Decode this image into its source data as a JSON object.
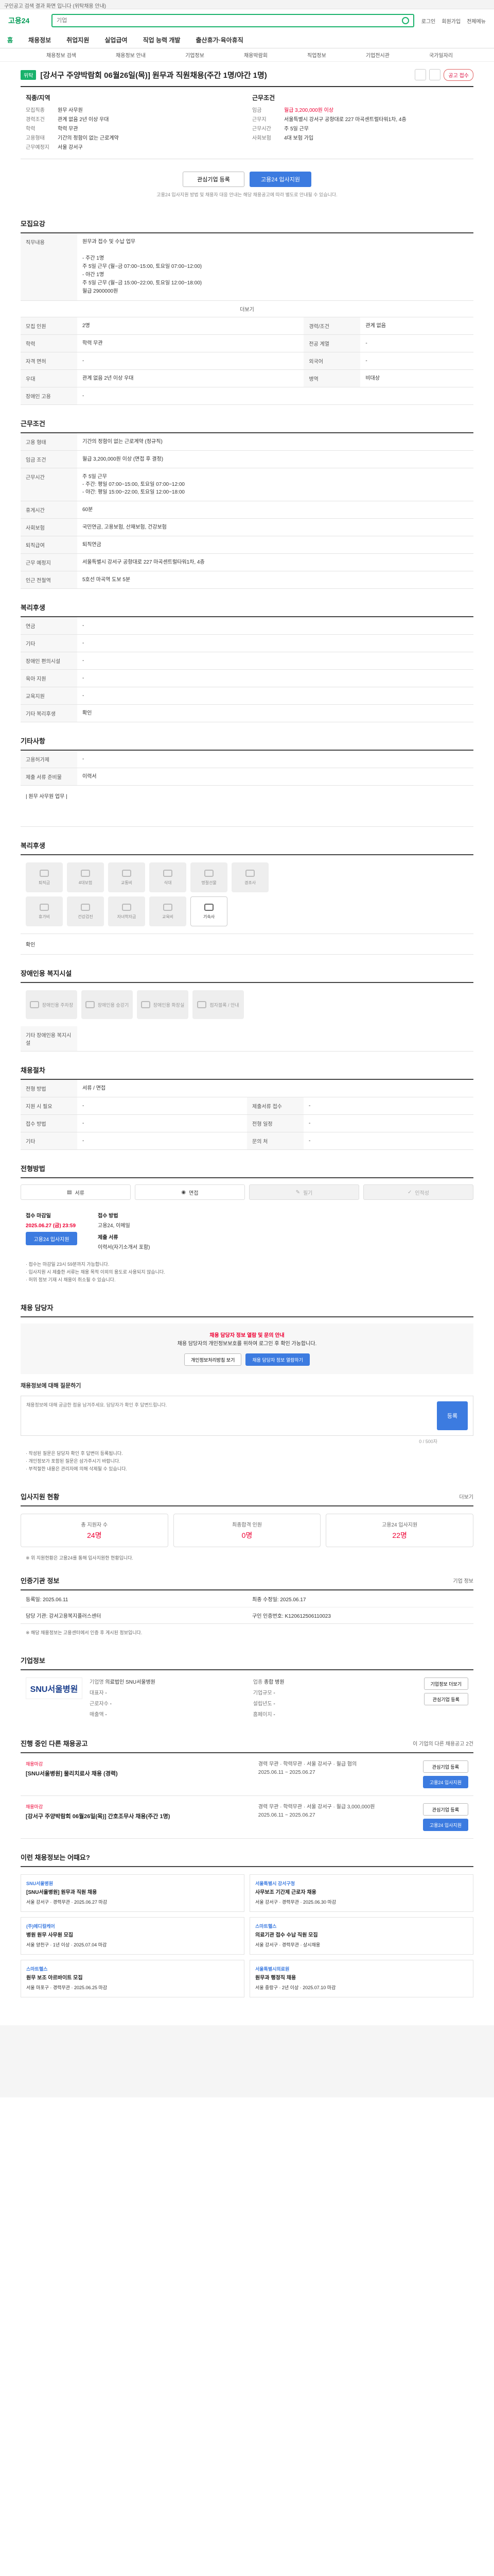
{
  "notice": "구인공고 검색 결과 화면 입니다 (위탁채용 안내)",
  "header": {
    "logo": "고용24",
    "search_placeholder": "기업",
    "menu": [
      "로그인",
      "회원가입",
      "전체메뉴"
    ]
  },
  "gnb": [
    "홈",
    "채용정보",
    "취업지원",
    "실업급여",
    "직업 능력 개발",
    "출산휴가·육아휴직"
  ],
  "subtabs": [
    "채용정보 검색",
    "채용정보 안내",
    "기업정보",
    "채용박람회",
    "직업정보",
    "기업전시관",
    "국가일자리"
  ],
  "job": {
    "badge": "위탁",
    "title": "[강서구 주양박람회 06월26일(목)] 원무과 직원채용(주간 1명/야간 1명)",
    "apply_badge": "공고 접수"
  },
  "summary": {
    "left_title": "직종/지역",
    "left": [
      {
        "k": "모집직종",
        "v": "원무 사무원"
      },
      {
        "k": "경력조건",
        "v": "관계 없음 2년 이상 우대"
      },
      {
        "k": "학력",
        "v": "학력 무관"
      },
      {
        "k": "고용형태",
        "v": "기간의 정함이 없는 근로계약"
      },
      {
        "k": "근무예정지",
        "v": "서울 강서구"
      }
    ],
    "right_title": "근무조건",
    "right": [
      {
        "k": "임금",
        "v": "월급 3,200,000원 이상"
      },
      {
        "k": "근무지",
        "v": "서울특별시 강서구 공항대로 227 마곡센트럴타워1차, 4층"
      },
      {
        "k": "근무시간",
        "v": "주 5일 근무"
      },
      {
        "k": "사회보험",
        "v": "4대 보험 가입"
      }
    ]
  },
  "actions": {
    "interest": "관심기업 등록",
    "apply": "고용24 입사지원",
    "note": "고용24 입사지원 방법 및 채용자 대응 안내는 해당 채용공고에 따라 별도로 안내될 수 있습니다."
  },
  "recruit": {
    "title": "모집요강",
    "job_desc_label": "직무내용",
    "job_desc": "원무과 접수 및 수납 업무\n\n- 주간 1명\n  주 5일 근무 (월~금 07:00~15:00, 토요일 07:00~12:00)\n- 야간 1명\n  주 5일 근무 (월~금 15:00~22:00, 토요일 12:00~18:00)\n  월급 2900000원",
    "more": "더보기",
    "rows": [
      {
        "k": "모집 인원",
        "v": "2명",
        "k2": "경력/조건",
        "v2": "관계 없음"
      },
      {
        "k": "학력",
        "v": "학력 무관",
        "k2": "전공 계열",
        "v2": "-"
      },
      {
        "k": "자격 면허",
        "v": "-",
        "k2": "외국어",
        "v2": "-"
      },
      {
        "k": "우대",
        "v": "관계 없음 2년 이상 우대",
        "k2": "병역",
        "v2": "비대상"
      },
      {
        "k": "장애인 고용",
        "v": "-",
        "k2": "",
        "v2": ""
      }
    ]
  },
  "conditions": {
    "title": "근무조건",
    "rows": [
      {
        "k": "고용 형태",
        "v": "기간의 정함이 없는 근로계약 (정규직)"
      },
      {
        "k": "임금 조건",
        "v": "월급 3,200,000원 이상 (면접 후 결정)"
      },
      {
        "k": "근무시간",
        "v": "주 5일 근무\n- 주간: 평일 07:00~15:00, 토요일 07:00~12:00\n- 야간: 평일 15:00~22:00, 토요일 12:00~18:00"
      },
      {
        "k": "휴게시간",
        "v": "60분"
      },
      {
        "k": "사회보험",
        "v": "국민연금, 고용보험, 산재보험, 건강보험"
      },
      {
        "k": "퇴직급여",
        "v": "퇴직연금"
      },
      {
        "k": "근무 예정지",
        "v": "서울특별시 강서구 공항대로 227 마곡센트럴타워1차, 4층"
      },
      {
        "k": "인근 전철역",
        "v": "5호선 마곡역 도보 5분"
      }
    ]
  },
  "welfare": {
    "title": "복리후생",
    "rows": [
      {
        "k": "연금",
        "v": "-"
      },
      {
        "k": "기타",
        "v": "-"
      },
      {
        "k": "장애인 편의시설",
        "v": "-"
      },
      {
        "k": "육아 지원",
        "v": "-"
      },
      {
        "k": "교육지원",
        "v": "-"
      },
      {
        "k": "기타 복리후생",
        "v": "확인"
      }
    ]
  },
  "other": {
    "title": "기타사항",
    "rows": [
      {
        "k": "고용허가제",
        "v": "-"
      },
      {
        "k": "제출 서류 준비물",
        "v": "이력서"
      }
    ],
    "detail": "| 원무 사무원 업무 |"
  },
  "disability": {
    "title": "복리후생",
    "items": [
      "퇴직금",
      "4대보험",
      "교통비",
      "식대",
      "명절선물",
      "경조사",
      "휴가비",
      "건강검진",
      "자녀학자금",
      "교육비",
      "기숙사",
      "사내카페"
    ]
  },
  "disability_fac": {
    "title": "장애인용 복지시설",
    "items": [
      "장애인용 주차장",
      "장애인용 승강기",
      "장애인용 화장실",
      "점자블록 / 안내"
    ],
    "note": "기타 장애인용 복지시설"
  },
  "selection": {
    "title": "채용절차",
    "rows": [
      {
        "k": "전형 방법",
        "v": "서류 / 면접",
        "k2": "",
        "v2": ""
      },
      {
        "k": "지원 시 필요",
        "v": "-",
        "k2": "제출서류 접수",
        "v2": "-"
      },
      {
        "k": "접수 방법",
        "v": "-",
        "k2": "전형 일정",
        "v2": "-"
      },
      {
        "k": "기타",
        "v": "-",
        "k2": "문의 처",
        "v2": "-"
      }
    ]
  },
  "apply": {
    "title": "전형방법",
    "methods": [
      "서류",
      "면접",
      "필기",
      "인적성"
    ],
    "period_label": "접수 마감일",
    "period_value": "2025.06.27 (금) 23:59",
    "period_btn": "고용24 입사지원",
    "how_label": "접수 방법",
    "how_value": "고용24, 이메일",
    "docs_label": "제출 서류",
    "docs_value": "이력서(자기소개서 포함)",
    "bullets": [
      "· 접수는 마감일 23시 59분까지 가능합니다.",
      "· 입사지원 시 제출한 서류는 채용 목적 이외의 용도로 사용되지 않습니다.",
      "· 허위 정보 기재 시 채용이 취소될 수 있습니다."
    ]
  },
  "contact": {
    "title": "채용 담당자",
    "alert_red": "채용 담당자 정보 열람 및 문의 안내",
    "alert_text": "채용 담당자의 개인정보보호를 위하여 로그인 후 확인 가능합니다.",
    "btn1": "개인정보처리방침 보기",
    "btn2": "채용 담당자 정보 열람하기",
    "qa_title": "채용정보에 대해 질문하기",
    "qa_placeholder": "채용정보에 대해 궁금한 점을 남겨주세요. 담당자가 확인 후 답변드립니다.",
    "qa_btn": "등록",
    "qa_count": "0 / 500자",
    "bullets": [
      "· 작성된 질문은 담당자 확인 후 답변이 등록됩니다.",
      "· 개인정보가 포함된 질문은 삼가주시기 바랍니다.",
      "· 부적절한 내용은 관리자에 의해 삭제될 수 있습니다."
    ]
  },
  "stats": {
    "title": "입사지원 현황",
    "more": "더보기",
    "items": [
      {
        "label": "총 지원자 수",
        "num": "24명"
      },
      {
        "label": "최종합격 인원",
        "num": "0명"
      },
      {
        "label": "고용24 입사지원",
        "num": "22명"
      }
    ],
    "note": "※ 위 지원현황은 고용24를 통해 입사지원한 현황입니다."
  },
  "mgmt": {
    "title": "인증기관 정보",
    "more": "기업 정보",
    "rows": [
      "등록일: 2025.06.11",
      "최종 수정일: 2025.06.17",
      "담당 기관: 강서고용복지플러스센터",
      "구인 인증번호: K120612506110023"
    ],
    "note": "※ 해당 채용정보는 고용센터에서 인증 후 게시된 정보입니다."
  },
  "company": {
    "title": "기업정보",
    "logo": "SNU서울병원",
    "info": [
      {
        "k": "기업명",
        "v": "의료법인 SNU서울병원"
      },
      {
        "k": "업종",
        "v": "종합 병원"
      },
      {
        "k": "대표자",
        "v": "-"
      },
      {
        "k": "기업규모",
        "v": "-"
      },
      {
        "k": "근로자수",
        "v": "-"
      },
      {
        "k": "설립년도",
        "v": "-"
      },
      {
        "k": "매출액",
        "v": "-"
      },
      {
        "k": "홈페이지",
        "v": "-"
      }
    ],
    "btn1": "기업정보 더보기",
    "btn2": "관심기업 등록"
  },
  "jobs": {
    "title": "진행 중인 다른 채용공고",
    "sub": "이 기업의 다른 채용공고 2건",
    "items": [
      {
        "tag": "채용마감",
        "title": "[SNU서울병원] 물리치료사 채용 (경력)",
        "info": "경력 무관 · 학력무관 · 서울 강서구 · 월급 협의",
        "date": "2025.06.11 ~ 2025.06.27"
      },
      {
        "tag": "채용마감",
        "title": "[강서구 주양박람회 06월26일(목)] 간호조무사 채용(주간 1명)",
        "info": "경력 무관 · 학력무관 · 서울 강서구 · 월급 3,000,000원",
        "date": "2025.06.11 ~ 2025.06.27"
      }
    ]
  },
  "recommend": {
    "title": "이런 채용정보는 어때요?",
    "items": [
      {
        "co": "SNU서울병원",
        "t": "[SNU서울병원] 원무과 직원 채용",
        "d": "서울 강서구 · 경력무관 · 2025.06.27 마감"
      },
      {
        "co": "서울특별시 강서구청",
        "t": "사무보조 기간제 근로자 채용",
        "d": "서울 강서구 · 경력무관 · 2025.06.30 마감"
      },
      {
        "co": "(주)메디컬케어",
        "t": "병원 원무 사무원 모집",
        "d": "서울 양천구 · 1년 이상 · 2025.07.04 마감"
      },
      {
        "co": "스마트헬스",
        "t": "의료기관 접수 수납 직원 모집",
        "d": "서울 강서구 · 경력무관 · 상시채용"
      },
      {
        "co": "스마트헬스",
        "t": "원무 보조 아르바이트 모집",
        "d": "서울 마포구 · 경력무관 · 2025.06.25 마감"
      },
      {
        "co": "서울특별시의료원",
        "t": "원무과 행정직 채용",
        "d": "서울 중랑구 · 2년 이상 · 2025.07.10 마감"
      }
    ]
  }
}
